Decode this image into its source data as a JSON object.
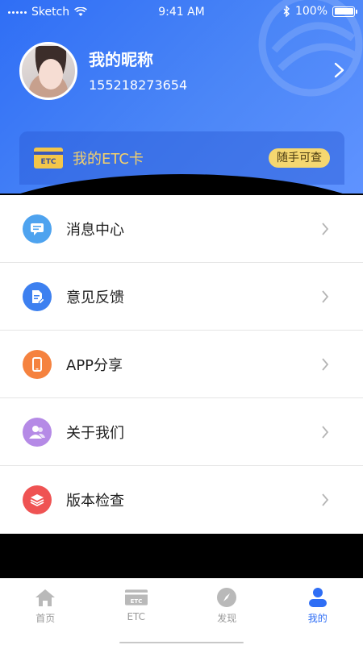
{
  "status_bar": {
    "carrier": "Sketch",
    "time": "9:41 AM",
    "battery": "100%"
  },
  "profile": {
    "nickname": "我的昵称",
    "phone": "155218273654"
  },
  "etc_card": {
    "title": "我的ETC卡",
    "badge": "随手可查",
    "icon_text": "ETC"
  },
  "menu": [
    {
      "label": "消息中心",
      "icon": "message-icon",
      "color": "#4ea3ef"
    },
    {
      "label": "意见反馈",
      "icon": "feedback-icon",
      "color": "#3d80f0"
    },
    {
      "label": "APP分享",
      "icon": "phone-icon",
      "color": "#f5823f"
    },
    {
      "label": "关于我们",
      "icon": "people-icon",
      "color": "#b58ae6"
    },
    {
      "label": "版本检查",
      "icon": "layers-icon",
      "color": "#ef5353"
    }
  ],
  "tabbar": {
    "items": [
      {
        "label": "首页",
        "icon": "home-icon",
        "active": false
      },
      {
        "label": "ETC",
        "icon": "etc-card-icon",
        "active": false
      },
      {
        "label": "发现",
        "icon": "compass-icon",
        "active": false
      },
      {
        "label": "我的",
        "icon": "user-icon",
        "active": true
      }
    ]
  },
  "colors": {
    "primary": "#2f6ef5",
    "etc_gold": "#f5d16a",
    "inactive": "#999999"
  }
}
